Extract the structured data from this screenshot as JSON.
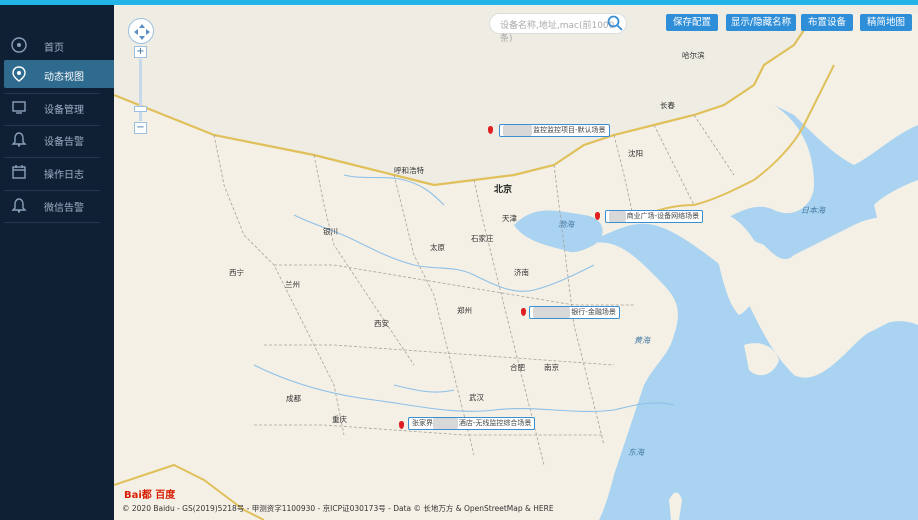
{
  "sidebar": {
    "items": [
      {
        "label": "首页",
        "icon": "dashboard-icon",
        "active": false
      },
      {
        "label": "动态视图",
        "icon": "location-icon",
        "active": true
      },
      {
        "label": "设备管理",
        "icon": "device-icon",
        "active": false
      },
      {
        "label": "设备告警",
        "icon": "bell-icon",
        "active": false
      },
      {
        "label": "操作日志",
        "icon": "calendar-icon",
        "active": false
      },
      {
        "label": "微信告警",
        "icon": "bell-icon",
        "active": false
      }
    ]
  },
  "toolbar": {
    "search_placeholder": "设备名称,地址,mac(前1000条)",
    "save_label": "保存配置",
    "toggle_names_label": "显示/隐藏名称",
    "deploy_label": "布置设备",
    "simple_map_label": "精简地图"
  },
  "markers": [
    {
      "name_visible": "监控监控项目-默认场景"
    },
    {
      "name_visible": "商业广场-设备网络场景"
    },
    {
      "name_visible": "银行-金融场景"
    },
    {
      "name_prefix": "张家界",
      "name_visible": "酒店-无线监控综合场景"
    }
  ],
  "map": {
    "cities_big": [
      "北京",
      "天津",
      "石家庄",
      "太原",
      "济南",
      "郑州",
      "西安",
      "武汉",
      "合肥",
      "南京",
      "重庆",
      "成都",
      "呼和浩特",
      "银川",
      "西宁",
      "兰州",
      "沈阳",
      "长春",
      "哈尔滨"
    ],
    "seas": [
      "渤海",
      "日本海",
      "黄海",
      "东海"
    ],
    "attribution": "© 2020 Baidu - GS(2019)5218号 - 甲测资字1100930 - 京ICP证030173号 - Data © 长地万方 & OpenStreetMap & HERE",
    "logo": "Bai都 百度"
  },
  "colors": {
    "sidebar_bg": "#0f2035",
    "active_item": "#2f6a8f",
    "button": "#2f8ed8",
    "top_strip": "#22b4e6",
    "land": "#f4f0e6",
    "sea": "#a9d3f0",
    "border": "#e0c05a",
    "marker": "#e02020"
  }
}
